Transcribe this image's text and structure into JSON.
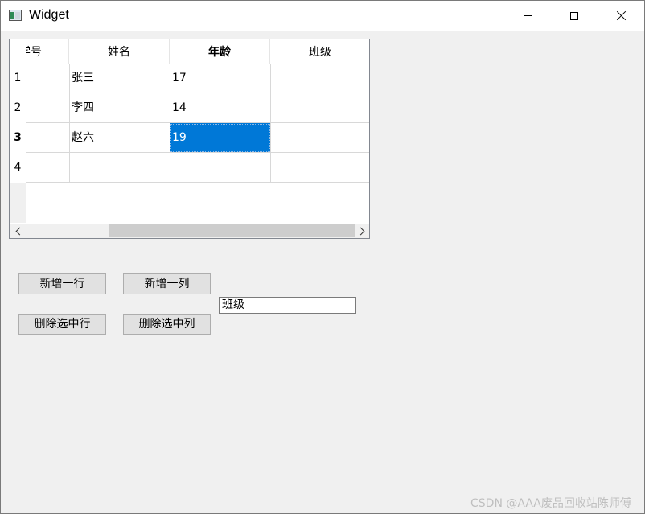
{
  "window": {
    "title": "Widget"
  },
  "table": {
    "columns": [
      "学号",
      "姓名",
      "年龄",
      "班级"
    ],
    "row_headers": [
      "1",
      "2",
      "3",
      "4"
    ],
    "rows": [
      [
        "",
        "张三",
        "17",
        ""
      ],
      [
        "",
        "李四",
        "14",
        ""
      ],
      [
        "",
        "赵六",
        "19",
        ""
      ],
      [
        "",
        "",
        "",
        ""
      ]
    ],
    "selected": {
      "row": 3,
      "column": "年龄"
    }
  },
  "buttons": {
    "add_row": "新增一行",
    "add_col": "新增一列",
    "del_row": "删除选中行",
    "del_col": "删除选中列"
  },
  "column_name_input": {
    "value": "班级"
  },
  "watermark": "CSDN @AAA废品回收站陈师傅",
  "colors": {
    "selection": "#0078d7",
    "background": "#f0f0f0"
  }
}
